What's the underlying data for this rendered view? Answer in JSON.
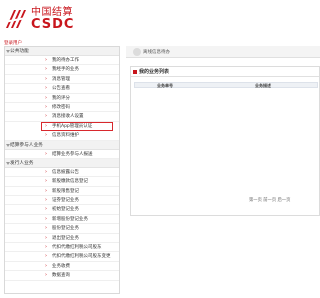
{
  "brand": {
    "name_cn": "中国结算",
    "name_en": "CSDC",
    "color": "#c8161d"
  },
  "login": "登录用户",
  "sections": [
    {
      "title": "公共功能",
      "items": [
        "我的待办工作",
        "我经手的业务",
        "消息管理",
        "公告查看",
        "我的评分",
        "修改密码",
        "消息接收人设置",
        "手机App管理员认证",
        "信息资料维护"
      ]
    },
    {
      "title": "结算参与人业务",
      "items": [
        "结算业务参与人报送"
      ]
    },
    {
      "title": "发行人业务",
      "items": [
        "信息披露公告",
        "新股缴款信息登记",
        "新股限售登记",
        "证券登记业务",
        "初始登记业务",
        "新增股份登记业务",
        "股份登记业务",
        "退出登记业务",
        "代扣代缴红利税公司股东",
        "代扣代缴红利税公司股东变更",
        "业务收费",
        "数据查询"
      ]
    }
  ],
  "highlighted": {
    "section": 0,
    "item": 7
  },
  "topbar": {
    "text": "离线信息待办"
  },
  "content": {
    "title": "我的业务列表",
    "columns": [
      "业务单号",
      "业务描述"
    ],
    "pager": "第一页  前一页  后一页"
  }
}
